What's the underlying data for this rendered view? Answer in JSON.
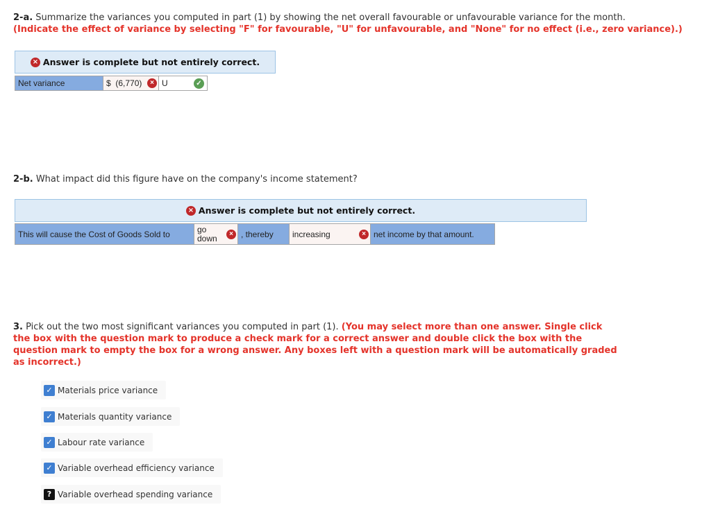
{
  "part_2a": {
    "number": "2-a.",
    "question": "Summarize the variances you computed in part (1) by showing the net overall favourable or unfavourable variance for the month.",
    "instruction": "(Indicate the effect of variance by selecting \"F\" for favourable, \"U\" for unfavourable, and \"None\" for no effect (i.e., zero variance).)",
    "feedback": "Answer is complete but not entirely correct.",
    "row": {
      "label": "Net variance",
      "currency": "$",
      "amount": "(6,770)",
      "amount_status": "incorrect",
      "effect": "U",
      "effect_status": "correct"
    }
  },
  "part_2b": {
    "number": "2-b.",
    "question": "What impact did this figure have on the company's income statement?",
    "feedback": "Answer is complete but not entirely correct.",
    "row": {
      "text1": "This will cause the Cost of Goods Sold to",
      "select1": "go down",
      "select1_status": "incorrect",
      "text2": ", thereby",
      "select2": "increasing",
      "select2_status": "incorrect",
      "text3": "net income by that amount."
    }
  },
  "part_3": {
    "number": "3.",
    "question": "Pick out the two most significant variances you computed in part (1).",
    "instruction": "(You may select more than one answer. Single click the box with the question mark to produce a check mark for a correct answer and double click the box with the question mark to empty the box for a wrong answer. Any boxes left with a question mark will be automatically graded as incorrect.)",
    "options": [
      {
        "label": "Materials price variance",
        "state": "checked"
      },
      {
        "label": "Materials quantity variance",
        "state": "checked"
      },
      {
        "label": "Labour rate variance",
        "state": "checked"
      },
      {
        "label": "Variable overhead efficiency variance",
        "state": "checked"
      },
      {
        "label": "Variable overhead spending variance",
        "state": "question"
      }
    ]
  },
  "icons": {
    "incorrect": "×",
    "correct": "✓",
    "checked": "✓",
    "question": "?"
  }
}
